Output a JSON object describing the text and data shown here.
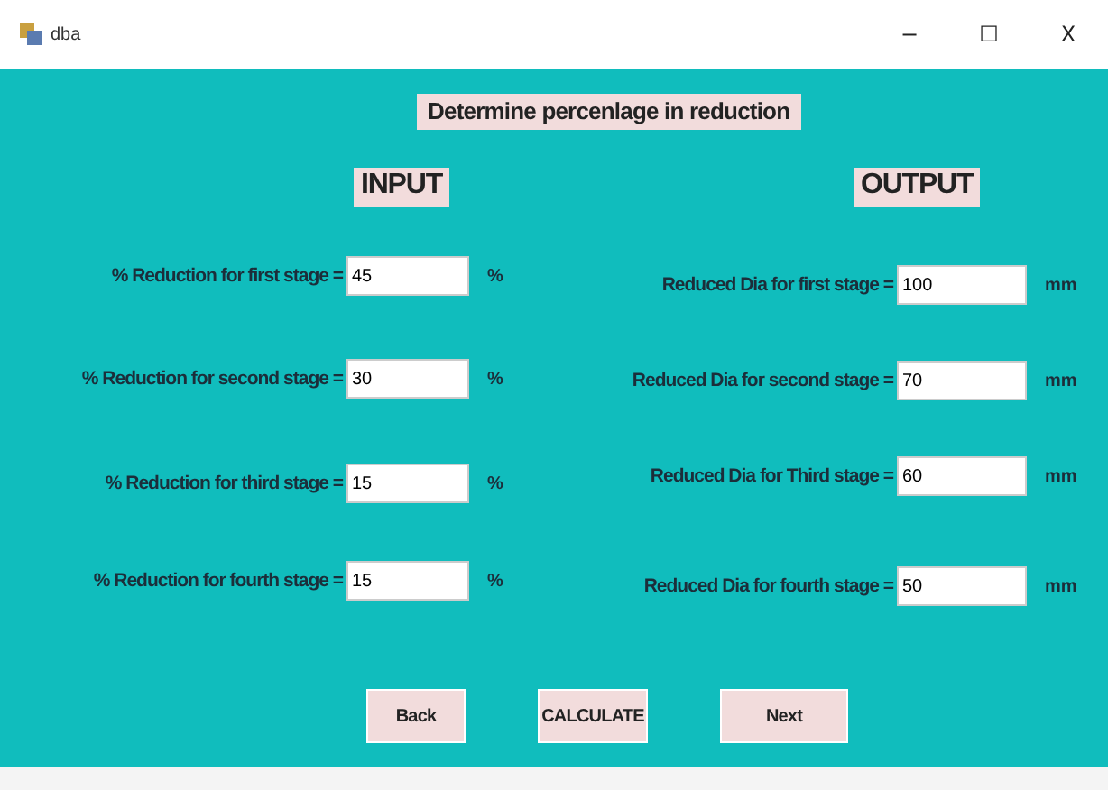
{
  "window": {
    "title": "dba",
    "controls": [
      "−",
      "☐",
      "X"
    ]
  },
  "heading": "Determine percenlage in reduction",
  "input": {
    "title": "INPUT",
    "rows": [
      {
        "label": "% Reduction for first stage =",
        "value": "45",
        "unit": "%"
      },
      {
        "label": "% Reduction for second stage =",
        "value": "30",
        "unit": "%"
      },
      {
        "label": "% Reduction for third stage =",
        "value": "15",
        "unit": "%"
      },
      {
        "label": "% Reduction for fourth stage =",
        "value": "15",
        "unit": "%"
      }
    ]
  },
  "output": {
    "title": "OUTPUT",
    "rows": [
      {
        "label": "Reduced Dia for first stage =",
        "value": "100",
        "unit": "mm"
      },
      {
        "label": "Reduced Dia for second stage =",
        "value": "70",
        "unit": "mm"
      },
      {
        "label": "Reduced Dia for Third stage =",
        "value": "60",
        "unit": "mm"
      },
      {
        "label": "Reduced Dia for fourth stage =",
        "value": "50",
        "unit": "mm"
      }
    ]
  },
  "buttons": [
    "Back",
    "CALCULATE",
    "Next"
  ]
}
